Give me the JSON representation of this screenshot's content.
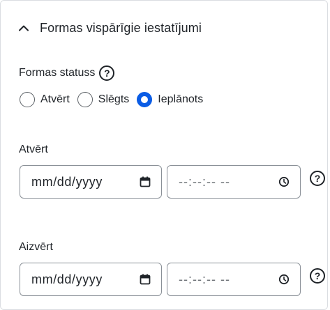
{
  "section": {
    "title": "Formas vispārīgie iestatījumi",
    "icon": "chevron-up-icon"
  },
  "status": {
    "label": "Formas statuss",
    "help": "?",
    "options": [
      {
        "label": "Atvērt",
        "checked": false
      },
      {
        "label": "Slēgts",
        "checked": false
      },
      {
        "label": "Ieplānots",
        "checked": true
      }
    ]
  },
  "open": {
    "label": "Atvērt",
    "date_placeholder": "mm/dd/yyyy",
    "time_placeholder": "--:--:-- --",
    "help": "?"
  },
  "close": {
    "label": "Aizvērt",
    "date_placeholder": "mm/dd/yyyy",
    "time_placeholder": "--:--:-- --",
    "help": "?"
  },
  "colors": {
    "accent": "#0a5ce5",
    "border": "#8a9097",
    "text": "#1f2328"
  }
}
